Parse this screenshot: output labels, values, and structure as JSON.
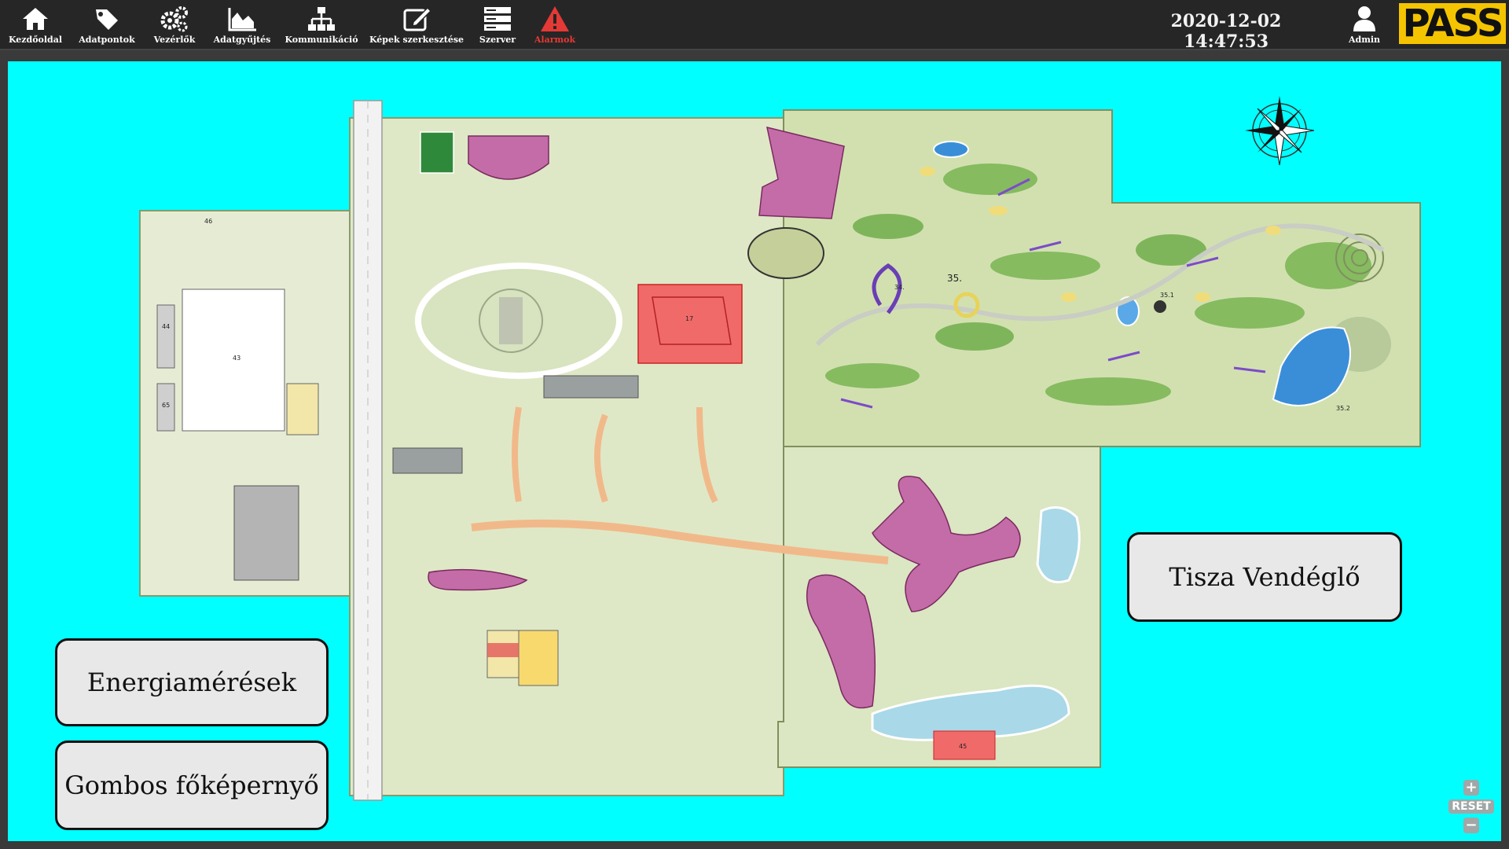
{
  "toolbar": {
    "items": [
      {
        "label": "Kezdőoldal",
        "icon": "home-icon"
      },
      {
        "label": "Adatpontok",
        "icon": "tags-icon"
      },
      {
        "label": "Vezérlők",
        "icon": "gears-icon"
      },
      {
        "label": "Adatgyűjtés",
        "icon": "area-chart-icon"
      },
      {
        "label": "Kommunikáció",
        "icon": "network-icon"
      },
      {
        "label": "Képek szerkesztése",
        "icon": "edit-icon"
      },
      {
        "label": "Szerver",
        "icon": "server-icon"
      },
      {
        "label": "Alarmok",
        "icon": "warning-icon"
      }
    ],
    "clock": "2020-12-02 14:47:53",
    "user": {
      "label": "Admin",
      "icon": "user-icon"
    },
    "logo": "PASS"
  },
  "buttons": {
    "tisza": "Tisza Vendéglő",
    "energia": "Energiamérések",
    "gombos": "Gombos főképernyő"
  },
  "map": {
    "labels": {
      "area35": "35.",
      "area35_1": "35.1",
      "area35_2": "35.2",
      "area34": "34.",
      "area17": "17",
      "area45": "45",
      "area46": "46",
      "area43": "43",
      "area44": "44",
      "area65": "65"
    }
  },
  "zoom": {
    "plus": "+",
    "reset": "RESET",
    "minus": "−"
  },
  "colors": {
    "canvas": "#00ffff",
    "toolbar": "#262626",
    "alarm": "#e53935",
    "logo_bg": "#f5c400",
    "highlight": "#f06a6a"
  }
}
